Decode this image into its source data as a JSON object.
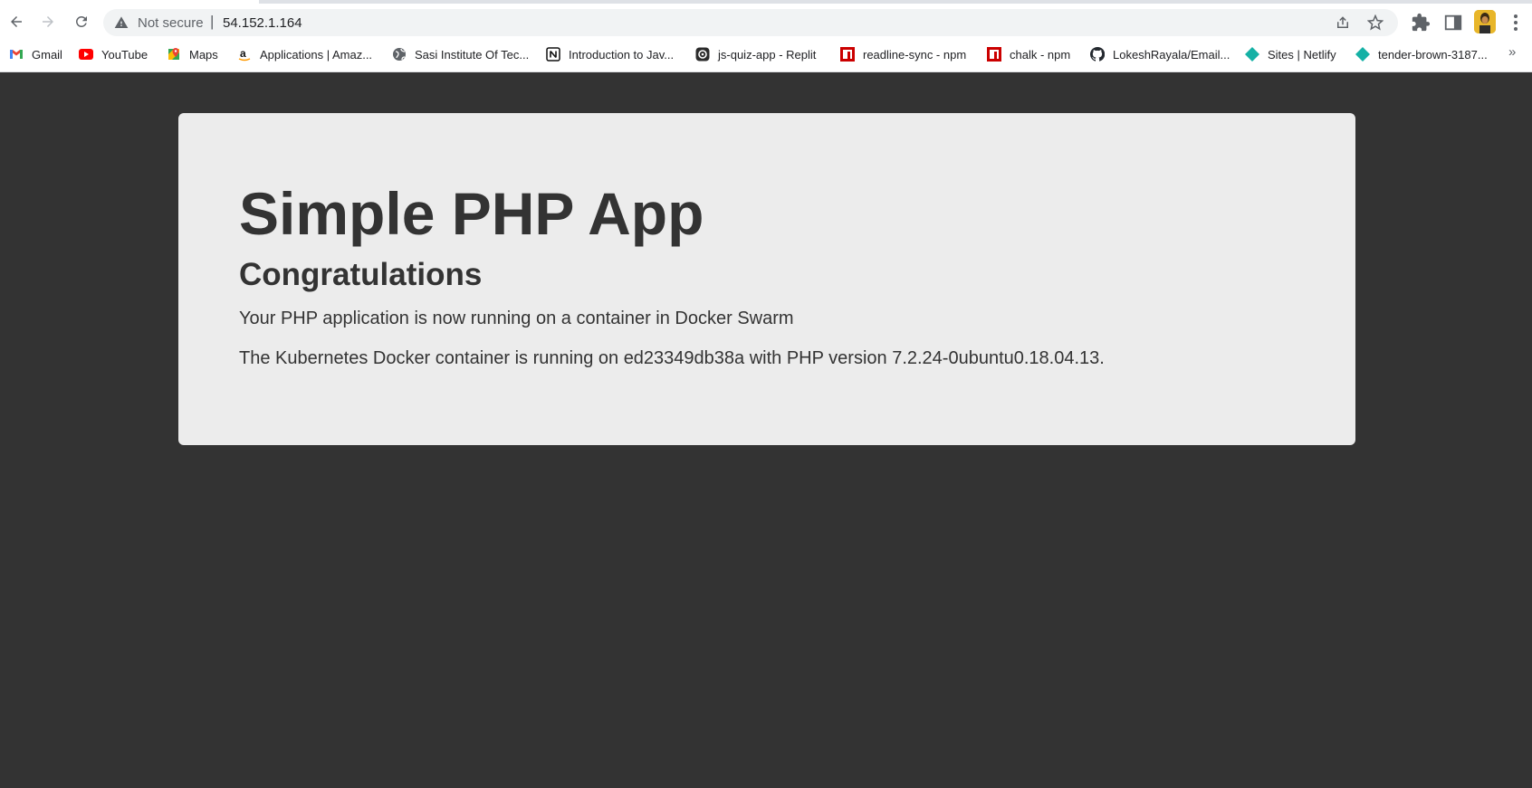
{
  "browser": {
    "security_label": "Not secure",
    "url": "54.152.1.164",
    "bookmarks": [
      {
        "label": "Gmail",
        "icon": "gmail-icon"
      },
      {
        "label": "YouTube",
        "icon": "youtube-icon"
      },
      {
        "label": "Maps",
        "icon": "maps-icon"
      },
      {
        "label": "Applications | Amaz...",
        "icon": "amazon-icon"
      },
      {
        "label": "Sasi Institute Of Tec...",
        "icon": "globe-icon"
      },
      {
        "label": "Introduction to Jav...",
        "icon": "notion-icon"
      },
      {
        "label": "js-quiz-app - Replit",
        "icon": "replit-icon"
      },
      {
        "label": "readline-sync - npm",
        "icon": "npm-icon"
      },
      {
        "label": "chalk - npm",
        "icon": "npm-icon"
      },
      {
        "label": "LokeshRayala/Email...",
        "icon": "github-icon"
      },
      {
        "label": "Sites | Netlify",
        "icon": "netlify-icon"
      },
      {
        "label": "tender-brown-3187...",
        "icon": "netlify-icon"
      }
    ],
    "more_bookmarks": "»"
  },
  "page": {
    "title": "Simple PHP App",
    "subtitle": "Congratulations",
    "message": "Your PHP application is now running on a container in Docker Swarm",
    "details": "The Kubernetes Docker container is running on ed23349db38a with PHP version 7.2.24-0ubuntu0.18.04.13."
  },
  "colors": {
    "background": "#333333",
    "card": "#ececec",
    "text": "#333333"
  }
}
